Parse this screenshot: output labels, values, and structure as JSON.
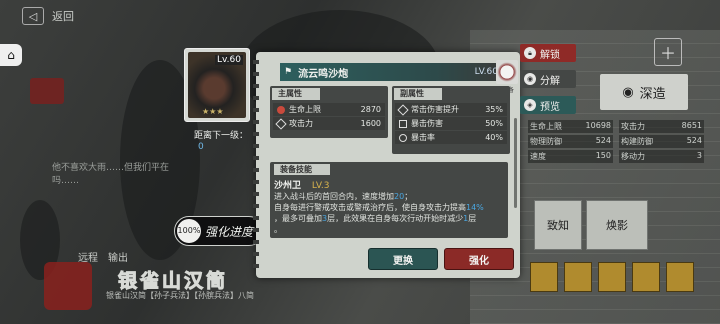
{
  "top": {
    "back_label": "返回"
  },
  "background": {
    "dialog": "他不喜欢大雨……但我们平在吗……",
    "tabs": [
      "远程",
      "输出"
    ],
    "place_title": "银雀山汉简",
    "place_sub": "银雀山汉简【孙子兵法】【孙膑兵法】八简",
    "shendao": "深造",
    "zhizhi": "致知",
    "huanying": "焕影",
    "right_stats": [
      [
        "生命上限",
        "10698"
      ],
      [
        "攻击力",
        "8651"
      ],
      [
        "物理防御",
        "524"
      ],
      [
        "构建防御",
        "524"
      ],
      [
        "速度",
        "150"
      ],
      [
        "移动力",
        "3"
      ]
    ]
  },
  "item_card": {
    "level": "Lv.60",
    "stars": "★★★"
  },
  "next_level": {
    "label": "距离下一级：",
    "value": "0"
  },
  "strengthen": {
    "percent": "100",
    "percent_sign": "%",
    "label": "强化进度"
  },
  "modal": {
    "name": "流云鸣沙炮",
    "level": "LV.60",
    "equipped": "已装备",
    "main_attr": {
      "header": "主属性",
      "rows": [
        {
          "label": "生命上限",
          "value": "2870"
        },
        {
          "label": "攻击力",
          "value": "1600"
        }
      ]
    },
    "sub_attr": {
      "header": "副属性",
      "rows": [
        {
          "label": "常击伤害提升",
          "value": "35%"
        },
        {
          "label": "暴击伤害",
          "value": "50%"
        },
        {
          "label": "暴击率",
          "value": "40%"
        }
      ]
    },
    "skill": {
      "header": "装备技能",
      "name": "沙州卫",
      "level_prefix": "LV.",
      "level": "3",
      "line1_a": "进入战斗后的首回合内，速度增加",
      "line1_b": "20",
      "line1_c": "；",
      "line2_a": "自身每进行警戒攻击或警戒治疗后，使自身攻击力提高",
      "line2_b": "14%",
      "line3_a": "，最多可叠加",
      "line3_b": "3",
      "line3_c": "层，此效果在自身每次行动开始时减少",
      "line3_d": "1",
      "line3_e": "层",
      "line4": "。"
    },
    "change_button": "更换",
    "upgrade_button": "强化"
  },
  "actions": {
    "unlock": "解锁",
    "dismantle": "分解",
    "preview": "预览"
  },
  "colors": {
    "teal": "#2b5553",
    "red": "#8b2a27",
    "highlight": "#4aa6e0",
    "gold": "#d7b34d"
  }
}
